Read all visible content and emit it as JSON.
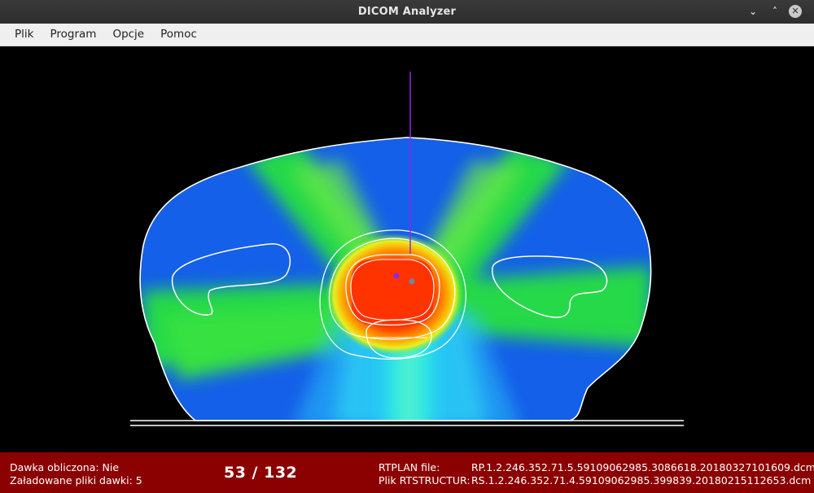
{
  "window": {
    "title": "DICOM Analyzer",
    "minimize_glyph": "⌄",
    "maximize_glyph": "˄",
    "close_glyph": "✕"
  },
  "menu": {
    "items": [
      {
        "label": "Plik"
      },
      {
        "label": "Program"
      },
      {
        "label": "Opcje"
      },
      {
        "label": "Pomoc"
      }
    ]
  },
  "status": {
    "dose_calculated_label": "Dawka obliczona: Nie",
    "loaded_dose_files_label": "Załadowane pliki dawki: 5",
    "slice_counter": "53 / 132",
    "rtplan_label": "RTPLAN file:",
    "rtplan_value": "RP.1.2.246.352.71.5.59109062985.3086618.20180327101609.dcm",
    "rtstruct_label": "Plik RTSTRUCTUR:",
    "rtstruct_value": "RS.1.2.246.352.71.4.59109062985.399839.20180215112653.dcm"
  },
  "colors": {
    "statusbar": "#8b0000",
    "body_fill": "#1560e8",
    "beam_green": "#28e040",
    "beam_cyan": "#30e8e0",
    "target_red": "#ff3300",
    "contour": "#ffffff",
    "crosshair": "#8a2be2"
  }
}
